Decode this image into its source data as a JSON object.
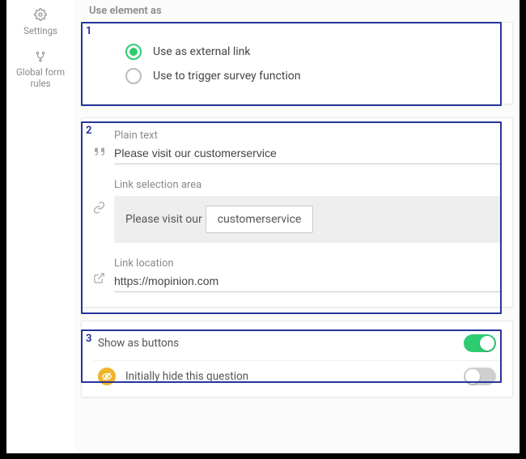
{
  "sidebar": {
    "items": [
      {
        "label": "Settings"
      },
      {
        "label": "Global form rules"
      }
    ]
  },
  "sections": {
    "useElementAs": {
      "title": "Use element as",
      "option1": "Use as external link",
      "option2": "Use to trigger survey function",
      "selected": 0
    },
    "textBlock": {
      "plainText": {
        "label": "Plain text",
        "value": "Please visit our customerservice"
      },
      "linkSelection": {
        "label": "Link selection area",
        "prefix": "Please visit our",
        "word": "customerservice"
      },
      "linkLocation": {
        "label": "Link location",
        "value": "https://mopinion.com"
      }
    },
    "toggles": {
      "showAsButtons": {
        "label": "Show as buttons",
        "on": true
      },
      "initiallyHide": {
        "label": "Initially hide this question",
        "on": false
      }
    }
  },
  "highlights": {
    "box1": "1",
    "box2": "2",
    "box3": "3"
  }
}
